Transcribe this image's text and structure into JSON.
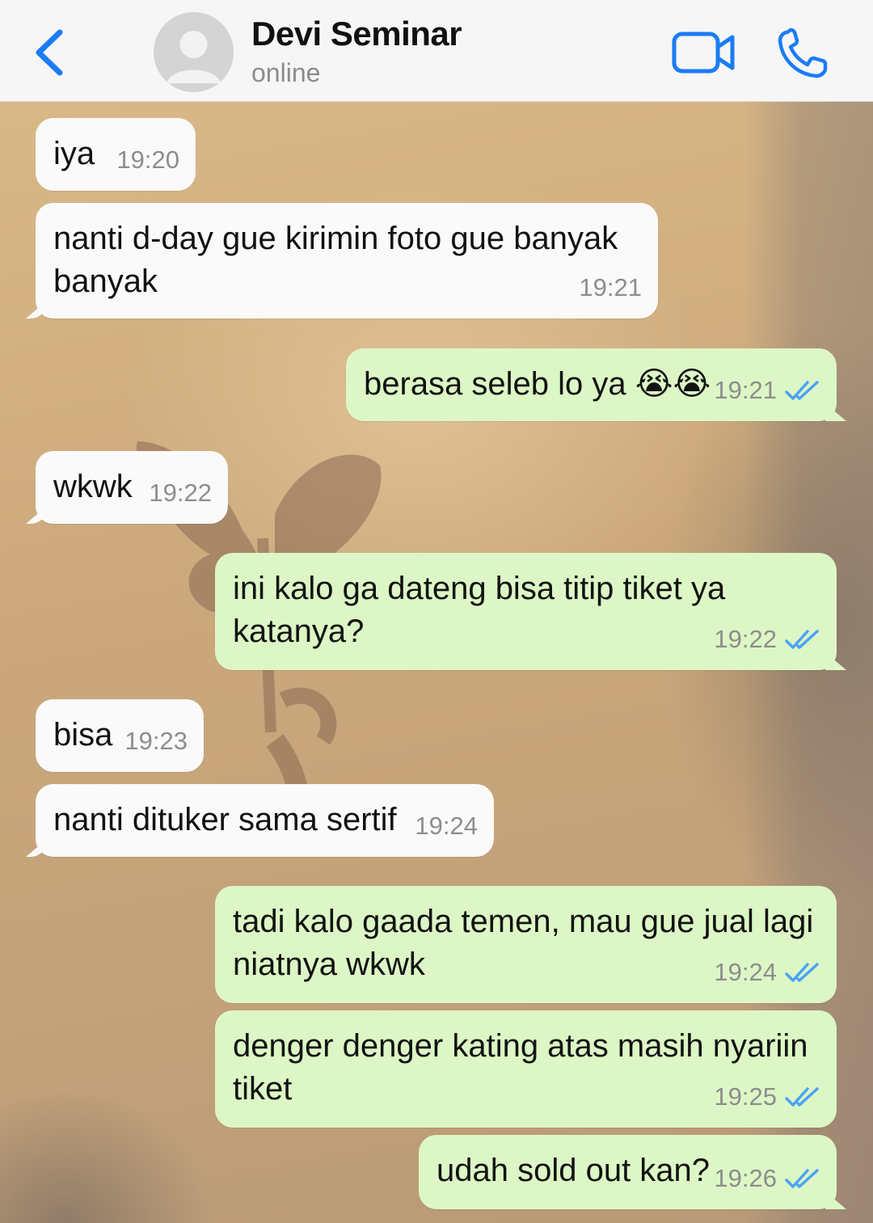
{
  "header": {
    "title": "Devi Seminar",
    "status": "online"
  },
  "colors": {
    "accent": "#1a7cf5",
    "incoming_bubble": "#fafafa",
    "outgoing_bubble": "#dcf7c5",
    "read_ticks": "#4aa3f7"
  },
  "icons": {
    "back": "chevron-left-icon",
    "avatar": "person-icon",
    "video": "video-camera-icon",
    "call": "phone-icon",
    "read": "double-check-icon"
  },
  "messages": [
    {
      "direction": "in",
      "text": "iya",
      "time": "19:20"
    },
    {
      "direction": "in",
      "text": "nanti d-day gue kirimin foto gue banyak banyak",
      "time": "19:21"
    },
    {
      "direction": "out",
      "text": "berasa seleb lo ya 😭😭",
      "time": "19:21",
      "read": true
    },
    {
      "direction": "in",
      "text": "wkwk",
      "time": "19:22"
    },
    {
      "direction": "out",
      "text": "ini kalo ga dateng bisa titip tiket ya katanya?",
      "time": "19:22",
      "read": true
    },
    {
      "direction": "in",
      "text": "bisa",
      "time": "19:23"
    },
    {
      "direction": "in",
      "text": "nanti dituker sama sertif",
      "time": "19:24"
    },
    {
      "direction": "out",
      "text": "tadi kalo gaada temen, mau gue jual lagi niatnya wkwk",
      "time": "19:24",
      "read": true
    },
    {
      "direction": "out",
      "text": "denger denger kating atas masih nyariin tiket",
      "time": "19:25",
      "read": true
    },
    {
      "direction": "out",
      "text": "udah sold out kan?",
      "time": "19:26",
      "read": true
    }
  ]
}
